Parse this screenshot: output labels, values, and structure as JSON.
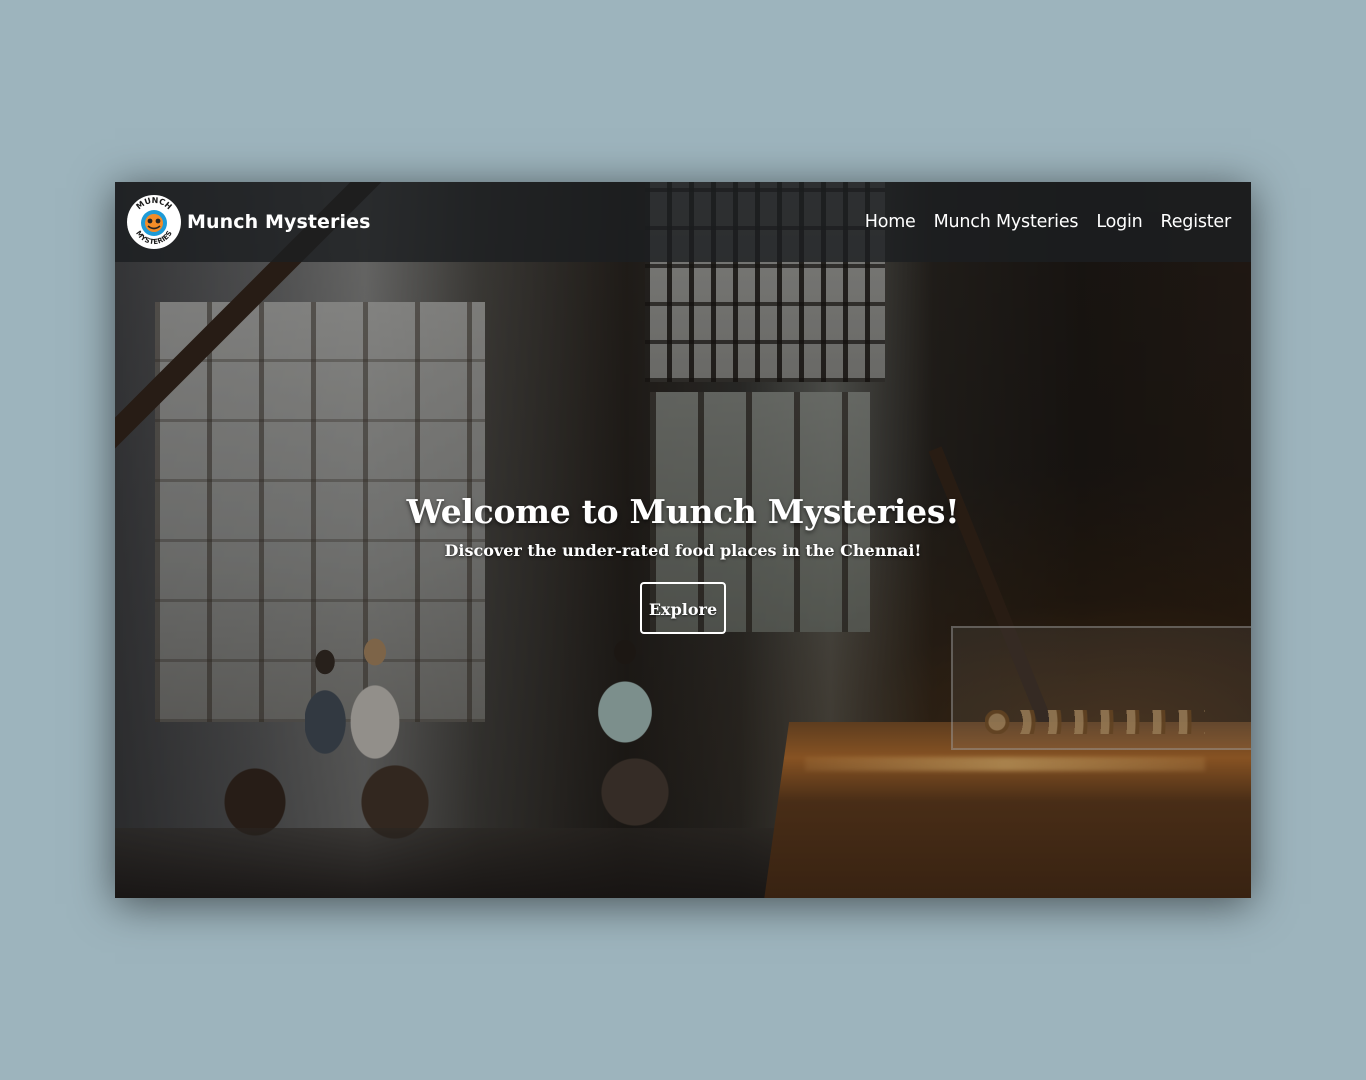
{
  "navbar": {
    "brand_name": "Munch Mysteries",
    "logo_text_top": "MUNCH",
    "logo_text_bottom": "MYSTERIES",
    "links": [
      {
        "label": "Home"
      },
      {
        "label": "Munch Mysteries"
      },
      {
        "label": "Login"
      },
      {
        "label": "Register"
      }
    ]
  },
  "hero": {
    "title": "Welcome to Munch Mysteries!",
    "subtitle": "Discover the under-rated food places in the Chennai!",
    "button_label": "Explore"
  },
  "colors": {
    "page_background": "#9db4bd",
    "navbar_background": "#1c1e21",
    "text": "#ffffff",
    "logo_accent": "#1e9bd7",
    "logo_secondary": "#f28c28"
  },
  "icons": {
    "brand_logo": "munch-mysteries-logo-icon"
  }
}
